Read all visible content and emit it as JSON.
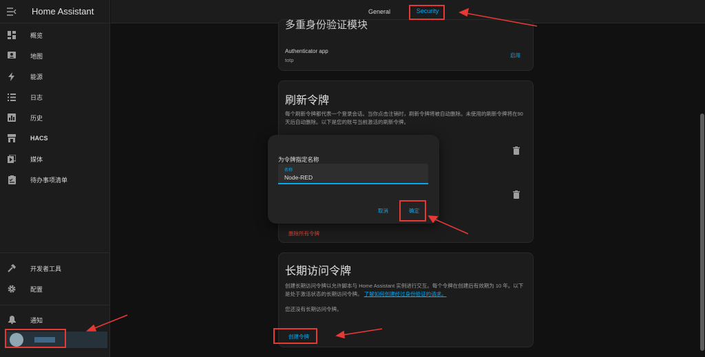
{
  "app": {
    "title": "Home Assistant"
  },
  "sidebar": {
    "items": [
      {
        "label": "概览",
        "icon": "dashboard-icon"
      },
      {
        "label": "地图",
        "icon": "map-icon"
      },
      {
        "label": "能源",
        "icon": "lightning-icon"
      },
      {
        "label": "日志",
        "icon": "list-icon"
      },
      {
        "label": "历史",
        "icon": "chart-icon"
      },
      {
        "label": "HACS",
        "icon": "hacs-icon"
      },
      {
        "label": "媒体",
        "icon": "media-icon"
      },
      {
        "label": "待办事项清单",
        "icon": "clipboard-icon"
      }
    ],
    "developer_tools": "开发者工具",
    "settings": "配置",
    "notifications": "通知"
  },
  "tabs": {
    "general": "General",
    "security": "Security"
  },
  "mfa_card": {
    "title_partial": "多重身份验证模块",
    "app_name": "Authenticator app",
    "app_id": "totp",
    "enable_button": "启用"
  },
  "refresh_card": {
    "title": "刷新令牌",
    "description": "每个刷新令牌都代表一个登录会话。当你点击注销时，刷新令牌将被自动删除。未使用的刷新令牌将在90天后自动删除。以下是您的账号当前激活的刷新令牌。",
    "delete_all": "删除所有令牌"
  },
  "long_lived_card": {
    "title": "长期访问令牌",
    "description": "创建长期访问令牌以允许脚本与 Home Assistant 实例进行交互。每个令牌在创建后有效期为 10 年。以下是处于激活状态的长期访问令牌。",
    "learn_link": "了解如何创建经过身份验证的请求。",
    "empty_text": "您还没有长期访问令牌。",
    "create_button": "创建令牌"
  },
  "dialog": {
    "title": "为令牌指定名称",
    "field_label": "名称",
    "field_value": "Node-RED",
    "cancel": "取消",
    "ok": "确定"
  },
  "colors": {
    "accent": "#03a9f4",
    "danger": "#db4437",
    "highlight": "#e53935"
  }
}
